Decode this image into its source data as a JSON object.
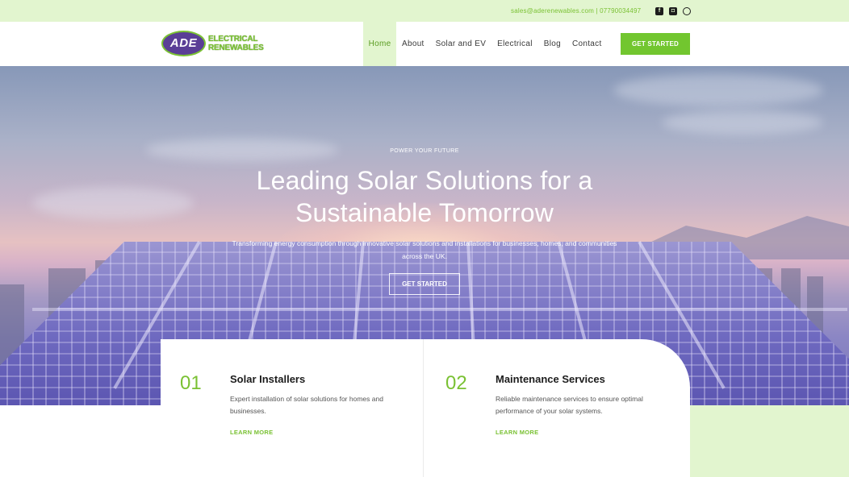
{
  "topbar": {
    "contact": "sales@aderenewables.com | 07790034497",
    "socials": [
      {
        "icon": "facebook-icon",
        "glyph": "f"
      },
      {
        "icon": "instagram-icon",
        "glyph": "◘"
      },
      {
        "icon": "whatsapp-icon",
        "glyph": ""
      }
    ]
  },
  "logo": {
    "badge": "ADE",
    "line1": "ELECTRICAL",
    "line2": "RENEWABLES"
  },
  "nav": {
    "items": [
      "Home",
      "About",
      "Solar and EV",
      "Electrical",
      "Blog",
      "Contact"
    ],
    "active": "Home",
    "cta": "GET STARTED"
  },
  "hero": {
    "eyebrow": "POWER YOUR FUTURE",
    "title": "Leading Solar Solutions for a Sustainable Tomorrow",
    "subtitle": "Transforming energy consumption through innovative solar solutions and installations for businesses, homes, and communities across the UK.",
    "cta": "GET STARTED"
  },
  "services": [
    {
      "number": "01",
      "title": "Solar Installers",
      "description": "Expert installation of solar solutions for homes and businesses.",
      "link": "LEARN MORE"
    },
    {
      "number": "02",
      "title": "Maintenance Services",
      "description": "Reliable maintenance services to ensure optimal performance of your solar systems.",
      "link": "LEARN MORE"
    }
  ],
  "colors": {
    "accent": "#7ac133",
    "accent_light": "#e2f5cf",
    "button": "#72c62f",
    "brand_purple": "#5a3e96"
  }
}
